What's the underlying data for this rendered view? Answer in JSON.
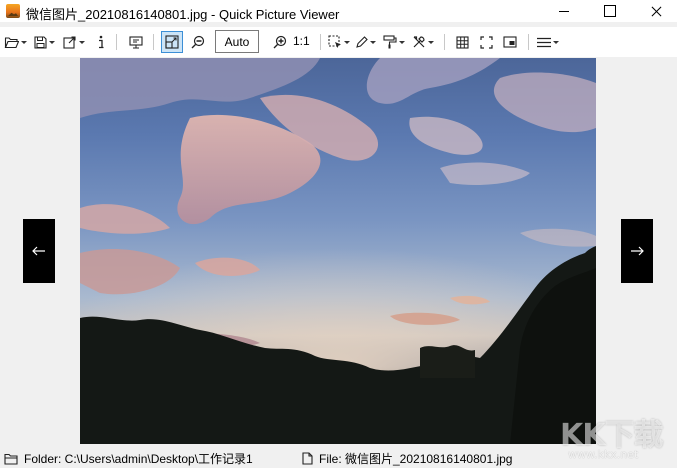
{
  "window": {
    "title": "微信图片_20210816140801.jpg - Quick Picture Viewer"
  },
  "toolbar": {
    "items": [
      {
        "icon": "open-folder-icon",
        "dropdown": true
      },
      {
        "icon": "save-icon",
        "dropdown": true
      },
      {
        "icon": "export-icon",
        "dropdown": true
      },
      {
        "icon": "info-icon"
      },
      {
        "icon": "slideshow-icon"
      },
      {
        "icon": "fit-to-window-icon",
        "active": true
      },
      {
        "icon": "zoom-out-icon"
      },
      {
        "icon": "zoom-in-icon"
      },
      {
        "icon": "selection-icon",
        "dropdown": true
      },
      {
        "icon": "edit-pen-icon",
        "dropdown": true
      },
      {
        "icon": "paint-roller-icon",
        "dropdown": true
      },
      {
        "icon": "tools-icon",
        "dropdown": true
      },
      {
        "icon": "grid-icon"
      },
      {
        "icon": "fullscreen-icon"
      },
      {
        "icon": "picture-in-picture-icon"
      },
      {
        "icon": "menu-icon",
        "dropdown": true
      }
    ],
    "zoom_mode": "Auto",
    "actual_size_label": "1:1"
  },
  "viewer": {
    "prev_icon": "arrow-left-icon",
    "next_icon": "arrow-right-icon"
  },
  "statusbar": {
    "folder_icon": "folder-icon",
    "folder_text": "Folder: C:\\Users\\admin\\Desktop\\工作记录1",
    "file_icon": "file-icon",
    "file_text": "File: 微信图片_20210816140801.jpg"
  },
  "watermark": {
    "logo": "KK下载",
    "url": "www.kkx.net"
  }
}
